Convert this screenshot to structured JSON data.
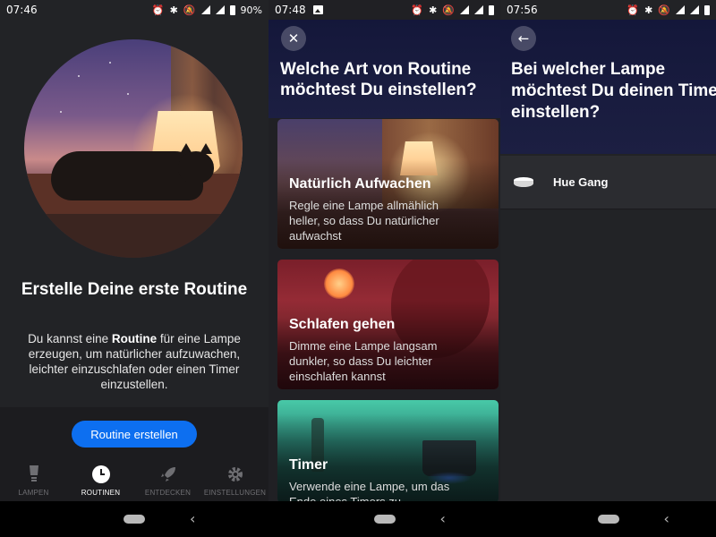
{
  "screen1": {
    "status": {
      "time": "07:46",
      "battery": "90%"
    },
    "title": "Erstelle Deine erste Routine",
    "body_pre": "Du kannst eine ",
    "body_bold": "Routine",
    "body_post": " für eine Lampe erzeugen, um natürlicher aufzuwachen, leichter einzuschlafen oder einen Timer einzustellen.",
    "cta_label": "Routine erstellen",
    "tabs": [
      {
        "label": "LAMPEN",
        "icon": "bulb-icon",
        "active": false
      },
      {
        "label": "ROUTINEN",
        "icon": "clock-icon",
        "active": true
      },
      {
        "label": "ENTDECKEN",
        "icon": "rocket-icon",
        "active": false
      },
      {
        "label": "EINSTELLUNGEN",
        "icon": "gear-icon",
        "active": false
      }
    ]
  },
  "screen2": {
    "status": {
      "time": "07:48"
    },
    "close_icon": "✕",
    "title_line1": "Welche Art von Routine",
    "title_line2": "möchtest Du einstellen?",
    "cards": [
      {
        "title": "Natürlich Aufwachen",
        "desc": "Regle eine Lampe allmählich heller, so dass Du natürlicher aufwachst"
      },
      {
        "title": "Schlafen gehen",
        "desc": "Dimme eine Lampe langsam dunkler, so dass Du leichter einschlafen kannst"
      },
      {
        "title": "Timer",
        "desc": "Verwende eine Lampe, um das Ende eines Timers zu"
      }
    ]
  },
  "screen3": {
    "status": {
      "time": "07:56"
    },
    "back_icon": "←",
    "title_line1": "Bei welcher Lampe",
    "title_line2": "möchtest Du deinen Timer",
    "title_line3": "einstellen?",
    "lamp_name": "Hue Gang"
  },
  "system_nav": {
    "back_glyph": "‹"
  }
}
